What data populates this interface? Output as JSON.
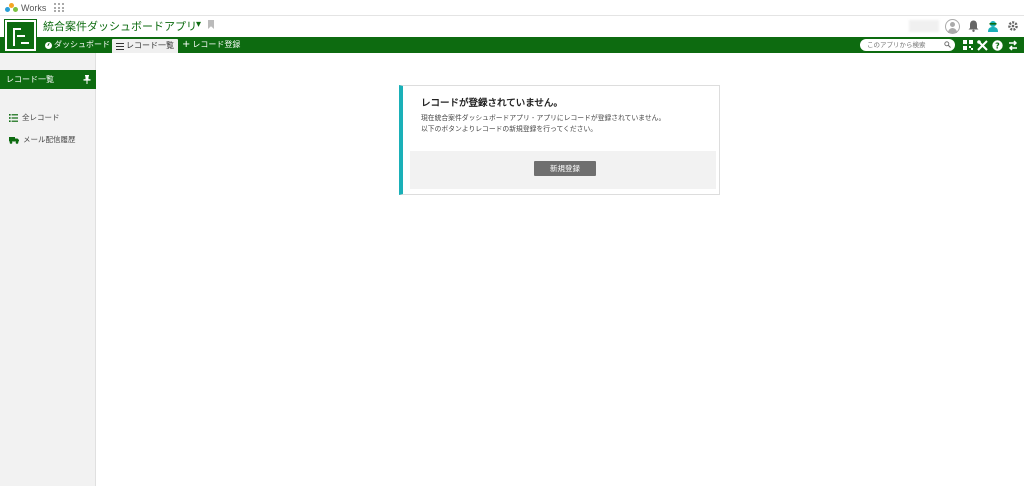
{
  "works_bar": {
    "logo_text": "Works",
    "logo_colors": [
      "#2a9fd6",
      "#f5a623",
      "#7cc242"
    ]
  },
  "header": {
    "app_title": "統合案件ダッシュボードアプリ",
    "title_caret": "▾"
  },
  "nav": {
    "items": [
      {
        "label": "ダッシュボード",
        "icon": "dashboard-icon"
      },
      {
        "label": "レコード一覧",
        "icon": "list-icon",
        "active": true
      },
      {
        "label": "レコード登録",
        "icon": "plus-icon"
      }
    ],
    "add_prefix": "+",
    "search_placeholder": "このアプリから検索"
  },
  "sidebar": {
    "heading": "レコード一覧",
    "items": [
      {
        "label": "全レコード",
        "icon": "list-icon"
      },
      {
        "label": "メール配信履歴",
        "icon": "truck-icon"
      }
    ]
  },
  "notice": {
    "title": "レコードが登録されていません。",
    "line1": "現在統合案件ダッシュボードアプリ - アプリにレコードが登録されていません。",
    "line2": "以下のボタンよりレコードの新規登録を行ってください。",
    "button_label": "新規登録"
  },
  "colors": {
    "brand_green": "#0d6b10",
    "accent_teal": "#1ab0b8",
    "button_gray": "#6f6f6f"
  }
}
